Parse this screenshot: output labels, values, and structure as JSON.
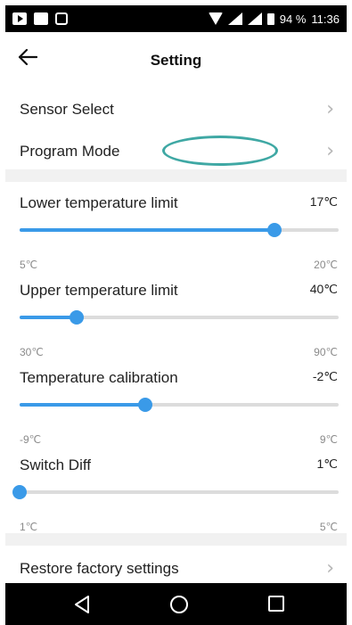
{
  "status_bar": {
    "battery": "94 %",
    "time": "11:36",
    "icons": [
      "youtube-icon",
      "gallery-icon",
      "bug-icon",
      "wifi-icon",
      "signal-icon",
      "signal-icon",
      "battery-icon"
    ]
  },
  "header": {
    "title": "Setting",
    "back_icon": "arrow-left-icon"
  },
  "menu_top": [
    {
      "label": "Sensor Select"
    },
    {
      "label": "Program Mode"
    }
  ],
  "sliders": [
    {
      "label": "Lower temperature limit",
      "value": "17℃",
      "min": "5℃",
      "max": "20℃",
      "fraction": 0.8
    },
    {
      "label": "Upper temperature limit",
      "value": "40℃",
      "min": "30℃",
      "max": "90℃",
      "fraction": 0.18
    },
    {
      "label": "Temperature calibration",
      "value": "-2℃",
      "min": "-9℃",
      "max": "9℃",
      "fraction": 0.395
    },
    {
      "label": "Switch Diff",
      "value": "1℃",
      "min": "1℃",
      "max": "5℃",
      "fraction": 0.0
    }
  ],
  "menu_bottom": [
    {
      "label": "Restore factory settings"
    }
  ],
  "nav_bar": {
    "icons": [
      "back-triangle-icon",
      "home-circle-icon",
      "recent-apps-square-icon"
    ]
  },
  "colors": {
    "accent": "#3a9ae8",
    "highlight": "#3fa8a4",
    "separator": "#f1f1f1"
  }
}
